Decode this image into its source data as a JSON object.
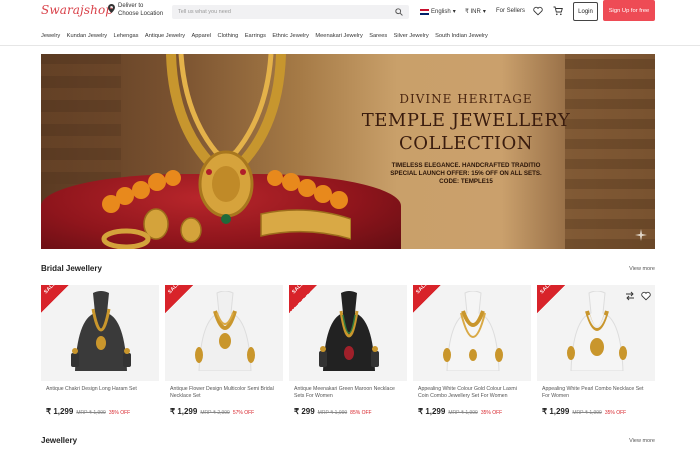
{
  "header": {
    "logo": "Swarajshop",
    "deliver_line1": "Deliver to",
    "deliver_line2": "Choose Location",
    "search_placeholder": "Tell us what you need",
    "language": "English",
    "currency": "₹ INR",
    "for_sellers": "For Sellers",
    "login_label": "Login",
    "signup_label": "Sign Up for free",
    "accent_color": "#ee4b55"
  },
  "categories": [
    "Jewelry",
    "Kundan Jewelry",
    "Lehengas",
    "Antique Jewelry",
    "Apparel",
    "Clothing",
    "Earrings",
    "Ethnic Jewelry",
    "Meenakari Jewelry",
    "Sarees",
    "Silver Jewelry",
    "South Indian Jewelry"
  ],
  "banner": {
    "subtitle": "DIVINE HERITAGE",
    "title_line1": "TEMPLE JEWELLERY",
    "title_line2": "COLLECTION",
    "desc_line1": "Timeless Elegance. Handcrafted Traditio",
    "desc_line2": "Special Launch Offer: 15% off on all sets.",
    "desc_line3": "Code: TEMPLE15"
  },
  "sections": {
    "bridal_title": "Bridal Jewellery",
    "bridal_view_more": "View more",
    "jewellery_title": "Jewellery",
    "jewellery_view_more": "View more"
  },
  "products": [
    {
      "sale": "SALE",
      "name": "Antique Chakri Design Long Haram Set",
      "price": "₹ 1,299",
      "mrp": "MRP ₹ 1,999",
      "off": "35% OFF",
      "bust": "#3a3a3a"
    },
    {
      "sale": "SALE",
      "name": "Antique Flower Design Multicolor Semi Bridal Necklace Set",
      "price": "₹ 1,299",
      "mrp": "MRP ₹ 2,999",
      "off": "57% OFF",
      "bust": "#f0f0f0"
    },
    {
      "sale": "SALE",
      "name": "Antique Meenakari Green Maroon Necklace Sets For Women",
      "price": "₹ 299",
      "mrp": "MRP ₹ 1,999",
      "off": "85% OFF",
      "bust": "#222222"
    },
    {
      "sale": "SALE",
      "name": "Appealing White Colour Gold Colour Laxmi Coin Combo Jewellery Set For Women",
      "price": "₹ 1,299",
      "mrp": "MRP ₹ 1,999",
      "off": "35% OFF",
      "bust": "#f5f5f5"
    },
    {
      "sale": "SALE",
      "name": "Appealing White Pearl Combo Necklace Set For Women",
      "price": "₹ 1,299",
      "mrp": "MRP ₹ 1,999",
      "off": "35% OFF",
      "bust": "#f5f5f5"
    }
  ]
}
